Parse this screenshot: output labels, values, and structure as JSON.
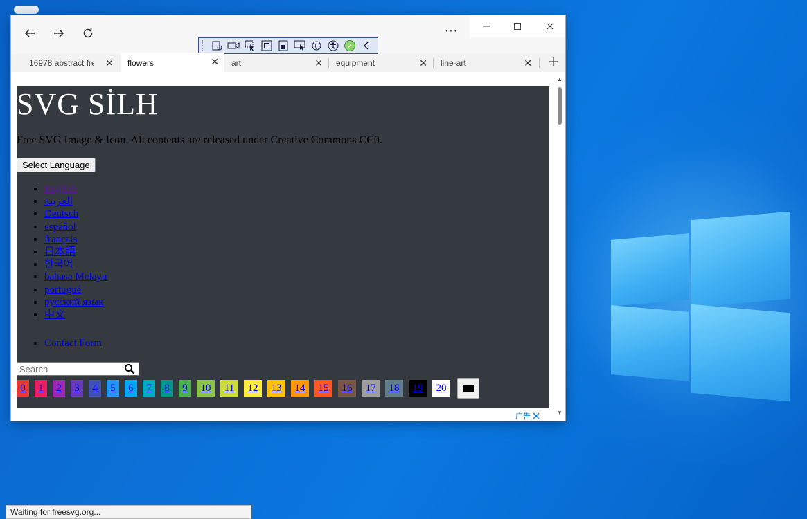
{
  "browser": {
    "tabs": [
      {
        "label": "16978 abstract fre",
        "active": false
      },
      {
        "label": "flowers",
        "active": true
      },
      {
        "label": "art",
        "active": false
      },
      {
        "label": "equipment",
        "active": false
      },
      {
        "label": "line-art",
        "active": false
      }
    ],
    "more_label": "···",
    "status": "Waiting for freesvg.org..."
  },
  "page": {
    "title": "SVG SİLH",
    "description": "Free SVG Image & Icon. All contents are released under Creative Commons CC0.",
    "language_button": "Select Language",
    "languages": [
      {
        "label": "English",
        "visited": true
      },
      {
        "label": "العربية",
        "visited": false
      },
      {
        "label": "Deutsch",
        "visited": false
      },
      {
        "label": "español",
        "visited": false
      },
      {
        "label": "français",
        "visited": false
      },
      {
        "label": "日本語",
        "visited": false
      },
      {
        "label": "한국어",
        "visited": false
      },
      {
        "label": "bahasa Melayu",
        "visited": false
      },
      {
        "label": "portugué",
        "visited": false
      },
      {
        "label": "русский язык",
        "visited": false
      },
      {
        "label": "中文",
        "visited": false
      }
    ],
    "contact": "Contact Form",
    "search_placeholder": "Search",
    "colors": [
      {
        "label": "0",
        "color": "#e53935"
      },
      {
        "label": "1",
        "color": "#e91e63"
      },
      {
        "label": "2",
        "color": "#9c27b0"
      },
      {
        "label": "3",
        "color": "#673ab7"
      },
      {
        "label": "4",
        "color": "#3f51b5"
      },
      {
        "label": "5",
        "color": "#2196f3"
      },
      {
        "label": "6",
        "color": "#03a9f4"
      },
      {
        "label": "7",
        "color": "#00acc1"
      },
      {
        "label": "8",
        "color": "#009688"
      },
      {
        "label": "9",
        "color": "#4caf50"
      },
      {
        "label": "10",
        "color": "#8bc34a"
      },
      {
        "label": "11",
        "color": "#cddc39"
      },
      {
        "label": "12",
        "color": "#ffeb3b"
      },
      {
        "label": "13",
        "color": "#ffc107"
      },
      {
        "label": "14",
        "color": "#ff9800"
      },
      {
        "label": "15",
        "color": "#ff5722"
      },
      {
        "label": "16",
        "color": "#795548"
      },
      {
        "label": "17",
        "color": "#9e9e9e"
      },
      {
        "label": "18",
        "color": "#607d8b"
      },
      {
        "label": "19",
        "color": "#000000"
      },
      {
        "label": "20",
        "color": "#ffffff"
      }
    ],
    "ad_label": "广告"
  }
}
